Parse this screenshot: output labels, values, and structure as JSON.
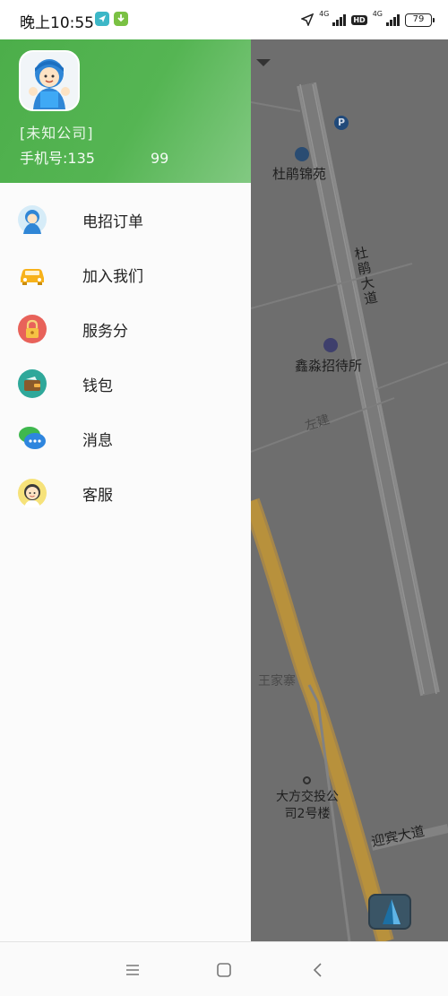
{
  "status_bar": {
    "time": "晚上10:55",
    "net_label_1": "4G",
    "net_label_2": "4G",
    "hd_badge": "HD",
    "battery": "79"
  },
  "drawer": {
    "company": "[未知公司]",
    "phone_label": "手机号: ",
    "phone_prefix": "135",
    "phone_suffix": "99",
    "menu": [
      {
        "label": "电招订单",
        "icon": "operator-avatar-icon"
      },
      {
        "label": "加入我们",
        "icon": "car-icon"
      },
      {
        "label": "服务分",
        "icon": "lock-icon"
      },
      {
        "label": "钱包",
        "icon": "wallet-icon"
      },
      {
        "label": "消息",
        "icon": "chat-bubble-icon"
      },
      {
        "label": "客服",
        "icon": "customer-service-avatar-icon"
      }
    ]
  },
  "map": {
    "labels": {
      "dupeng_jinyuan": "杜鹃锦苑",
      "dupeng_road": "杜鹃大道",
      "hotel": "鑫淼招待所",
      "zuojian": "左建",
      "wangjiazhai": "王家寨",
      "bus_company": "大方交投公司2号楼",
      "yingbin_road": "迎宾大道"
    },
    "parking_symbol": "P"
  },
  "colors": {
    "header_green": "#4cae4a",
    "map_overlay": "#6e6e6e",
    "road_orange": "#b8913c"
  }
}
